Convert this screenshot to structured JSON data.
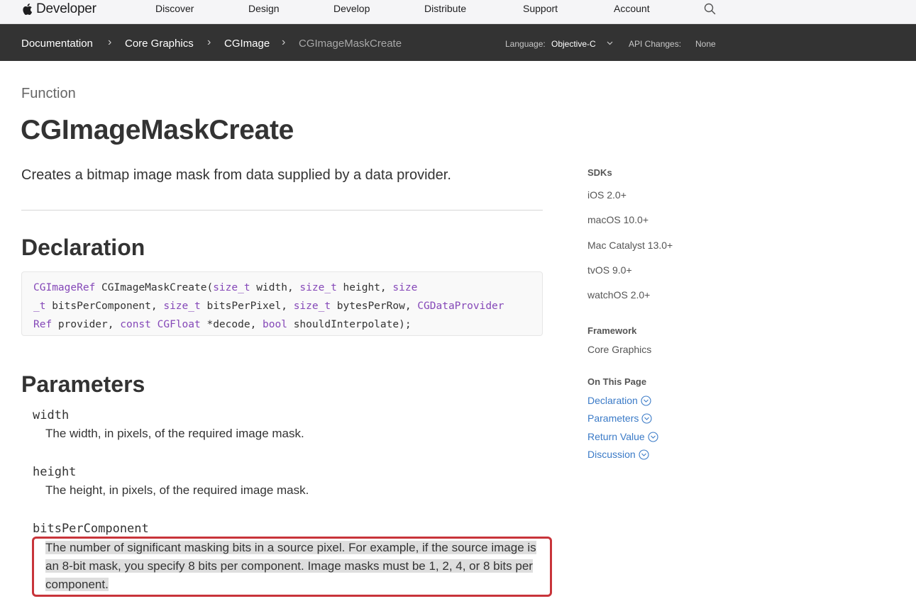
{
  "globalnav": {
    "brand": "Developer",
    "links": [
      "Discover",
      "Design",
      "Develop",
      "Distribute",
      "Support",
      "Account"
    ]
  },
  "breadcrumb": {
    "items": [
      "Documentation",
      "Core Graphics",
      "CGImage",
      "CGImageMaskCreate"
    ],
    "separator": "›",
    "language_label": "Language:",
    "language_value": "Objective-C",
    "api_changes_label": "API Changes:",
    "api_changes_value": "None"
  },
  "page": {
    "eyebrow": "Function",
    "title": "CGImageMaskCreate",
    "abstract": "Creates a bitmap image mask from data supplied by a data provider."
  },
  "declaration": {
    "heading": "Declaration",
    "tokens": {
      "t1": "CGImageRef",
      "t2": " CGImageMaskCreate(",
      "t3": "size_t",
      "t4": " width, ",
      "t5": "size_t",
      "t6": " height, ",
      "t7": "size",
      "t8": "_t",
      "t9": " bitsPerComponent, ",
      "t10": "size_t",
      "t11": " bitsPerPixel, ",
      "t12": "size_t",
      "t13": " bytesPerRow, ",
      "t14": "CGDataProvider",
      "t15": "Ref",
      "t16": " provider, ",
      "t17": "const",
      "t18": " ",
      "t19": "CGFloat",
      "t20": " *decode, ",
      "t21": "bool",
      "t22": " shouldInterpolate);"
    }
  },
  "parameters": {
    "heading": "Parameters",
    "items": [
      {
        "name": "width",
        "description": "The width, in pixels, of the required image mask."
      },
      {
        "name": "height",
        "description": "The height, in pixels, of the required image mask."
      },
      {
        "name": "bitsPerComponent",
        "description": "The number of significant masking bits in a source pixel. For example, if the source image is an 8-bit mask, you specify 8 bits per component. Image masks must be 1, 2, 4, or 8 bits per component."
      }
    ]
  },
  "sidebar": {
    "sdks_heading": "SDKs",
    "sdks": [
      "iOS 2.0+",
      "macOS 10.0+",
      "Mac Catalyst 13.0+",
      "tvOS 9.0+",
      "watchOS 2.0+"
    ],
    "framework_heading": "Framework",
    "framework": "Core Graphics",
    "on_this_page_heading": "On This Page",
    "on_this_page": [
      "Declaration",
      "Parameters",
      "Return Value",
      "Discussion"
    ]
  },
  "colors": {
    "link": "#3a7ac7",
    "code_type": "#8548b8",
    "highlight_border": "#c8343a",
    "localnav_bg": "#333333"
  }
}
